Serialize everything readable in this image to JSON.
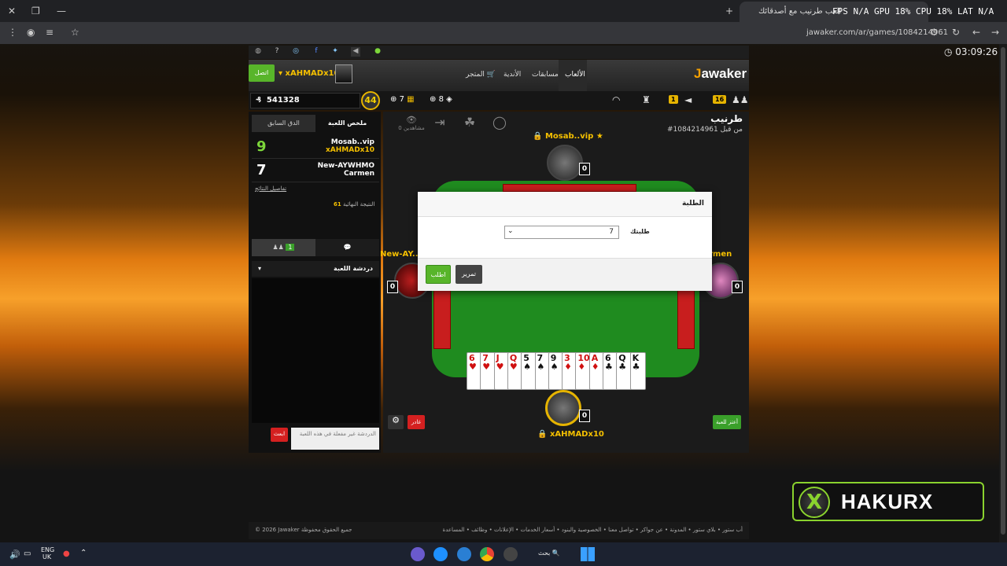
{
  "browser": {
    "tab_title": "العب طرنيب مع أصدقائك",
    "perf_text": "FPS N/A  GPU 18%  CPU 18%  LAT N/A",
    "url": "jawaker.com/ar/games/1084214961"
  },
  "site": {
    "clock": "03:09:26",
    "logo": "Jawaker",
    "nav": [
      "الألعاب",
      "مسابقات",
      "الأندية",
      "المتجر"
    ],
    "connect_label": "اتصل",
    "username": "xAHMADx10",
    "coins": "541328",
    "level": "44",
    "stat_a": "7",
    "stat_b": "8",
    "badge_friends": "16",
    "badge_alerts": "1"
  },
  "left_panel": {
    "tab_summary": "ملخص اللعبة",
    "tab_prev": "الدق السابق",
    "rows": [
      {
        "score": "9",
        "name1": "Mosab..vip",
        "name2": "xAHMADx10",
        "color": "#7cd63a"
      },
      {
        "score": "7",
        "name1": "New-AYWHMO",
        "name2": "Carmen",
        "color": "#ffffff"
      }
    ],
    "details_link": "تفاصيل النتائج",
    "final_label": "النتيجة النهائية",
    "final_value": "61",
    "players_count": "1",
    "chat_title": "دردشة اللعبة",
    "send_label": "ابعث",
    "chat_placeholder": "الدردشة غير مفعلة في هذه اللعبة"
  },
  "game": {
    "title": "طرنيب",
    "subtitle": "#1084214961 من قبل",
    "spectators": "0 مشاهدين",
    "top_player": "Mosab..vip",
    "left_player": "New-AY...",
    "right_player": "rmen",
    "bottom_player": "xAHMADx10",
    "counts": [
      "0",
      "0",
      "0",
      "0"
    ],
    "leave_label": "غادر",
    "gifts_label": "أعتز للعبة",
    "hand": [
      {
        "rank": "6",
        "suit": "♥",
        "color": "red"
      },
      {
        "rank": "7",
        "suit": "♥",
        "color": "red"
      },
      {
        "rank": "J",
        "suit": "♥",
        "color": "red"
      },
      {
        "rank": "Q",
        "suit": "♥",
        "color": "red"
      },
      {
        "rank": "5",
        "suit": "♠",
        "color": "black"
      },
      {
        "rank": "7",
        "suit": "♠",
        "color": "black"
      },
      {
        "rank": "9",
        "suit": "♠",
        "color": "black"
      },
      {
        "rank": "3",
        "suit": "♦",
        "color": "red"
      },
      {
        "rank": "10",
        "suit": "♦",
        "color": "red"
      },
      {
        "rank": "A",
        "suit": "♦",
        "color": "red"
      },
      {
        "rank": "6",
        "suit": "♣",
        "color": "black"
      },
      {
        "rank": "Q",
        "suit": "♣",
        "color": "black"
      },
      {
        "rank": "K",
        "suit": "♣",
        "color": "black"
      }
    ]
  },
  "modal": {
    "title": "الطلبة",
    "label": "طلبتك",
    "value": "7",
    "submit_label": "اطلب",
    "pass_label": "تمرير"
  },
  "footer": {
    "copyright": "© 2026 Jawaker جميع الحقوق محفوظة",
    "links": "أب ستور • بلاي ستور • المدونة • عن جواكر • تواصل معنا • الخصوصية والبنود • أسعار الخدمات • الإعلانات • وظائف • المساعدة"
  },
  "overlay": {
    "brand": "HAKURX"
  },
  "taskbar": {
    "lang": "ENG",
    "region": "UK",
    "search": "بحث"
  }
}
